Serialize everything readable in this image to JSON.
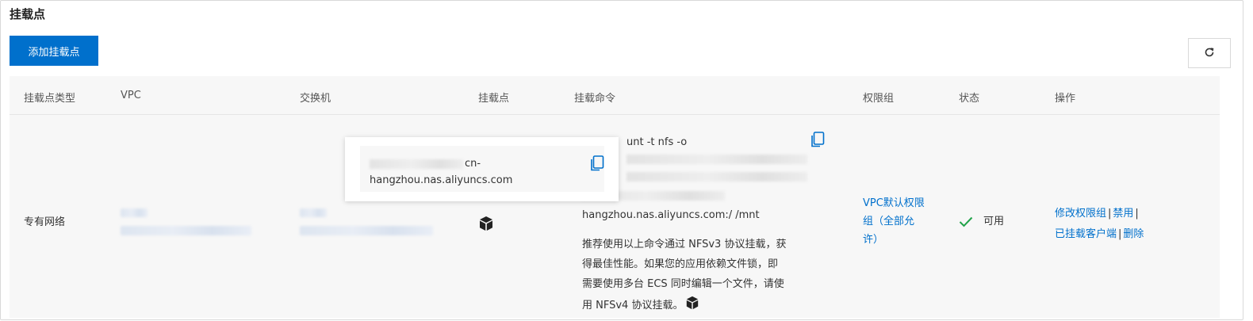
{
  "page": {
    "title": "挂载点"
  },
  "toolbar": {
    "add_label": "添加挂载点",
    "refresh_icon": "refresh-icon"
  },
  "table": {
    "columns": [
      "挂载点类型",
      "VPC",
      "交换机",
      "挂载点",
      "挂载命令",
      "权限组",
      "状态",
      "操作"
    ],
    "row": {
      "type": "专有网络",
      "mount_cmd_first": "unt -t nfs -o",
      "mount_cmd_last": "hangzhou.nas.aliyuncs.com:/ /mnt",
      "recommend_line1": "推荐使用以上命令通过 NFSv3 协议挂载，获",
      "recommend_line2": "得最佳性能。如果您的应用依赖文件锁，即",
      "recommend_line3": "需要使用多台 ECS 同时编辑一个文件，请使",
      "recommend_line4": "用 NFSv4 协议挂载。",
      "perm_group_line1": "VPC默认权限",
      "perm_group_line2": "组（全部允",
      "perm_group_line3": "许）",
      "status": "可用",
      "actions": {
        "modify_perm": "修改权限组",
        "disable": "禁用",
        "mounted_clients": "已挂载客户端",
        "delete": "删除"
      }
    }
  },
  "popover": {
    "line1_suffix": "cn-",
    "line2": "hangzhou.nas.aliyuncs.com"
  },
  "colors": {
    "primary": "#0070cc",
    "status_ok": "#22a34a",
    "header_bg": "#f7f7f7"
  }
}
